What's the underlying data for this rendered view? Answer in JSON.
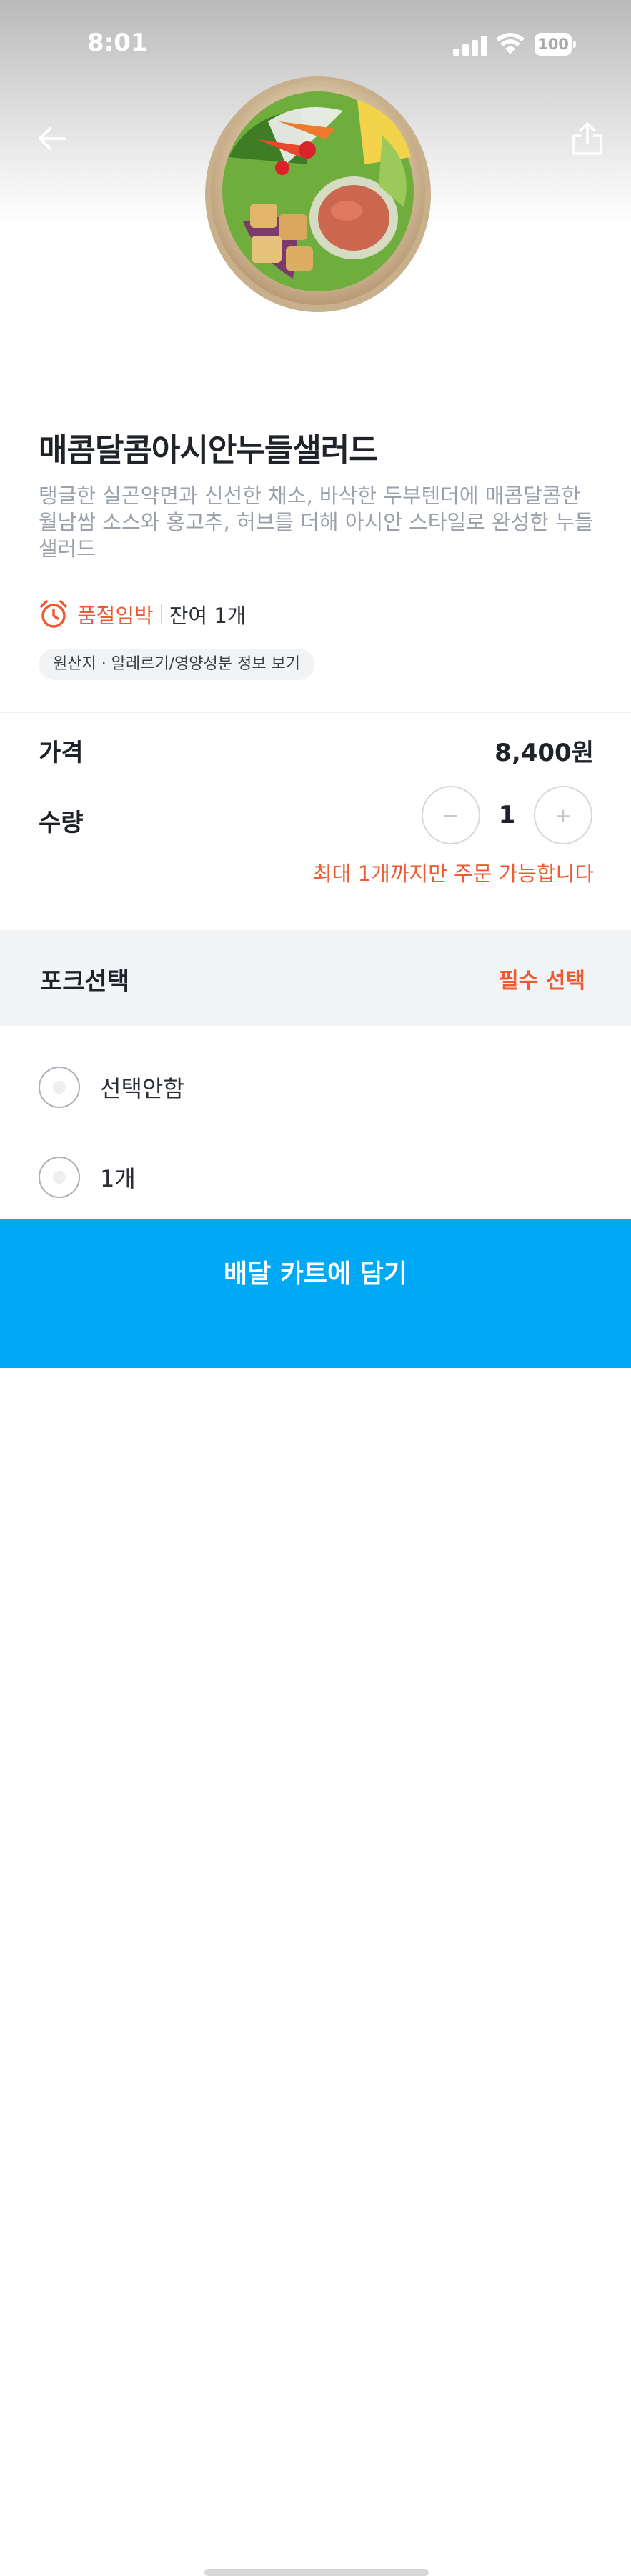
{
  "status_bar": {
    "time": "8:01",
    "battery": "100"
  },
  "product": {
    "title": "매콤달콤아시안누들샐러드",
    "description": "탱글한 실곤약면과 신선한 채소, 바삭한 두부텐더에 매콤달콤한 월남쌈 소스와 홍고추, 허브를 더해 아시안 스타일로 완성한 누들 샐러드",
    "stock_status": "품절임박",
    "stock_remaining": "잔여 1개",
    "info_link": "원산지 · 알레르기/영양성분 정보 보기"
  },
  "order": {
    "price_label": "가격",
    "price_value": "8,400원",
    "quantity_label": "수량",
    "quantity_value": "1",
    "minus_symbol": "−",
    "plus_symbol": "+",
    "limit_notice": "최대 1개까지만 주문 가능합니다"
  },
  "option_group": {
    "title": "포크선택",
    "required_label": "필수 선택",
    "options": [
      {
        "label": "선택안함"
      },
      {
        "label": "1개"
      }
    ]
  },
  "cta": {
    "label": "배달 카트에 담기"
  },
  "colors": {
    "accent_orange": "#ef5a32",
    "cta_blue": "#00a9f5",
    "description_gray": "#9aa1ab"
  },
  "icons": [
    "back-arrow-icon",
    "share-icon",
    "alarm-clock-icon"
  ]
}
